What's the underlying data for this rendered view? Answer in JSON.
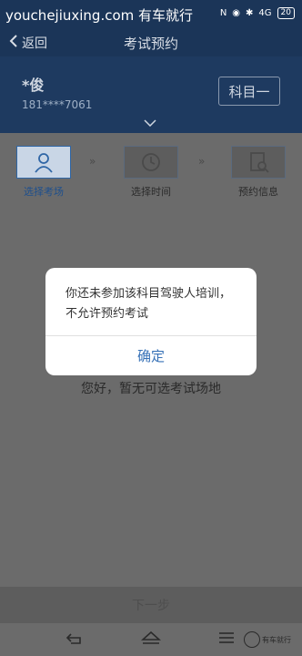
{
  "status_bar": {
    "watermark": "youchejiuxing.com 有车就行",
    "network": "4G",
    "battery": "20"
  },
  "nav": {
    "back_label": "返回",
    "title": "考试预约"
  },
  "profile": {
    "name": "*俊",
    "phone": "181****7061",
    "subject": "科目一"
  },
  "steps": [
    {
      "label": "选择考场",
      "icon": "person-icon",
      "active": true
    },
    {
      "label": "选择时间",
      "icon": "clock-icon",
      "active": false
    },
    {
      "label": "预约信息",
      "icon": "document-search-icon",
      "active": false
    }
  ],
  "empty_message": "您好，暂无可选考试场地",
  "next_button": "下一步",
  "modal": {
    "message": "你还未参加该科目驾驶人培训，不允许预约考试",
    "confirm": "确定"
  },
  "logo": {
    "text": "有车就行"
  },
  "colors": {
    "header": "#1b3558",
    "accent": "#3872b7",
    "overlay": "#6b6b6b"
  }
}
